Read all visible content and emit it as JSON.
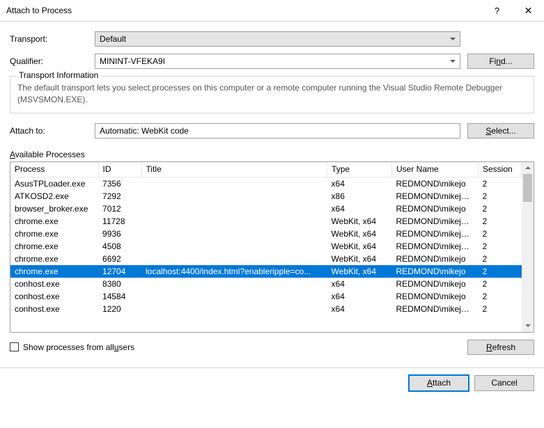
{
  "window": {
    "title": "Attach to Process",
    "help": "?",
    "close": "✕"
  },
  "labels": {
    "transport": "Transport:",
    "qualifier": "Qualifier:",
    "attach_to": "Attach to:",
    "available_prefix": "A",
    "available_rest": "vailable Processes"
  },
  "transport": {
    "value": "Default"
  },
  "qualifier": {
    "value": "MININT-VFEKA9I"
  },
  "attach_to": {
    "value": "Automatic: WebKit code"
  },
  "buttons": {
    "find_prefix": "Fi",
    "find_u": "n",
    "find_suffix": "d...",
    "select_u": "S",
    "select_rest": "elect...",
    "refresh_u": "R",
    "refresh_rest": "efresh",
    "attach_u": "A",
    "attach_rest": "ttach",
    "cancel": "Cancel"
  },
  "transport_info": {
    "title": "Transport Information",
    "text": "The default transport lets you select processes on this computer or a remote computer running the Visual Studio Remote Debugger (MSVSMON.EXE)."
  },
  "columns": {
    "process": "Process",
    "id": "ID",
    "title": "Title",
    "type": "Type",
    "user": "User Name",
    "session": "Session"
  },
  "show_all": {
    "prefix": "Show processes from all ",
    "u": "u",
    "suffix": "sers",
    "checked": false
  },
  "rows": [
    {
      "process": "AsusTPLoader.exe",
      "id": "7356",
      "title": "",
      "type": "x64",
      "user": "REDMOND\\mikejo",
      "session": "2",
      "sel": false
    },
    {
      "process": "ATKOSD2.exe",
      "id": "7292",
      "title": "",
      "type": "x86",
      "user": "REDMOND\\mikejo ...",
      "session": "2",
      "sel": false
    },
    {
      "process": "browser_broker.exe",
      "id": "7012",
      "title": "",
      "type": "x64",
      "user": "REDMOND\\mikejo",
      "session": "2",
      "sel": false
    },
    {
      "process": "chrome.exe",
      "id": "11728",
      "title": "",
      "type": "WebKit, x64",
      "user": "REDMOND\\mikejo ...",
      "session": "2",
      "sel": false
    },
    {
      "process": "chrome.exe",
      "id": "9936",
      "title": "",
      "type": "WebKit, x64",
      "user": "REDMOND\\mikejo ...",
      "session": "2",
      "sel": false
    },
    {
      "process": "chrome.exe",
      "id": "4508",
      "title": "",
      "type": "WebKit, x64",
      "user": "REDMOND\\mikejo ...",
      "session": "2",
      "sel": false
    },
    {
      "process": "chrome.exe",
      "id": "6692",
      "title": "",
      "type": "WebKit, x64",
      "user": "REDMOND\\mikejo",
      "session": "2",
      "sel": false
    },
    {
      "process": "chrome.exe",
      "id": "12704",
      "title": "localhost:4400/index.html?enableripple=co...",
      "type": "WebKit, x64",
      "user": "REDMOND\\mikejo",
      "session": "2",
      "sel": true
    },
    {
      "process": "conhost.exe",
      "id": "8380",
      "title": "",
      "type": "x64",
      "user": "REDMOND\\mikejo",
      "session": "2",
      "sel": false
    },
    {
      "process": "conhost.exe",
      "id": "14584",
      "title": "",
      "type": "x64",
      "user": "REDMOND\\mikejo",
      "session": "2",
      "sel": false
    },
    {
      "process": "conhost.exe",
      "id": "1220",
      "title": "",
      "type": "x64",
      "user": "REDMOND\\mikejo ...",
      "session": "2",
      "sel": false
    }
  ]
}
